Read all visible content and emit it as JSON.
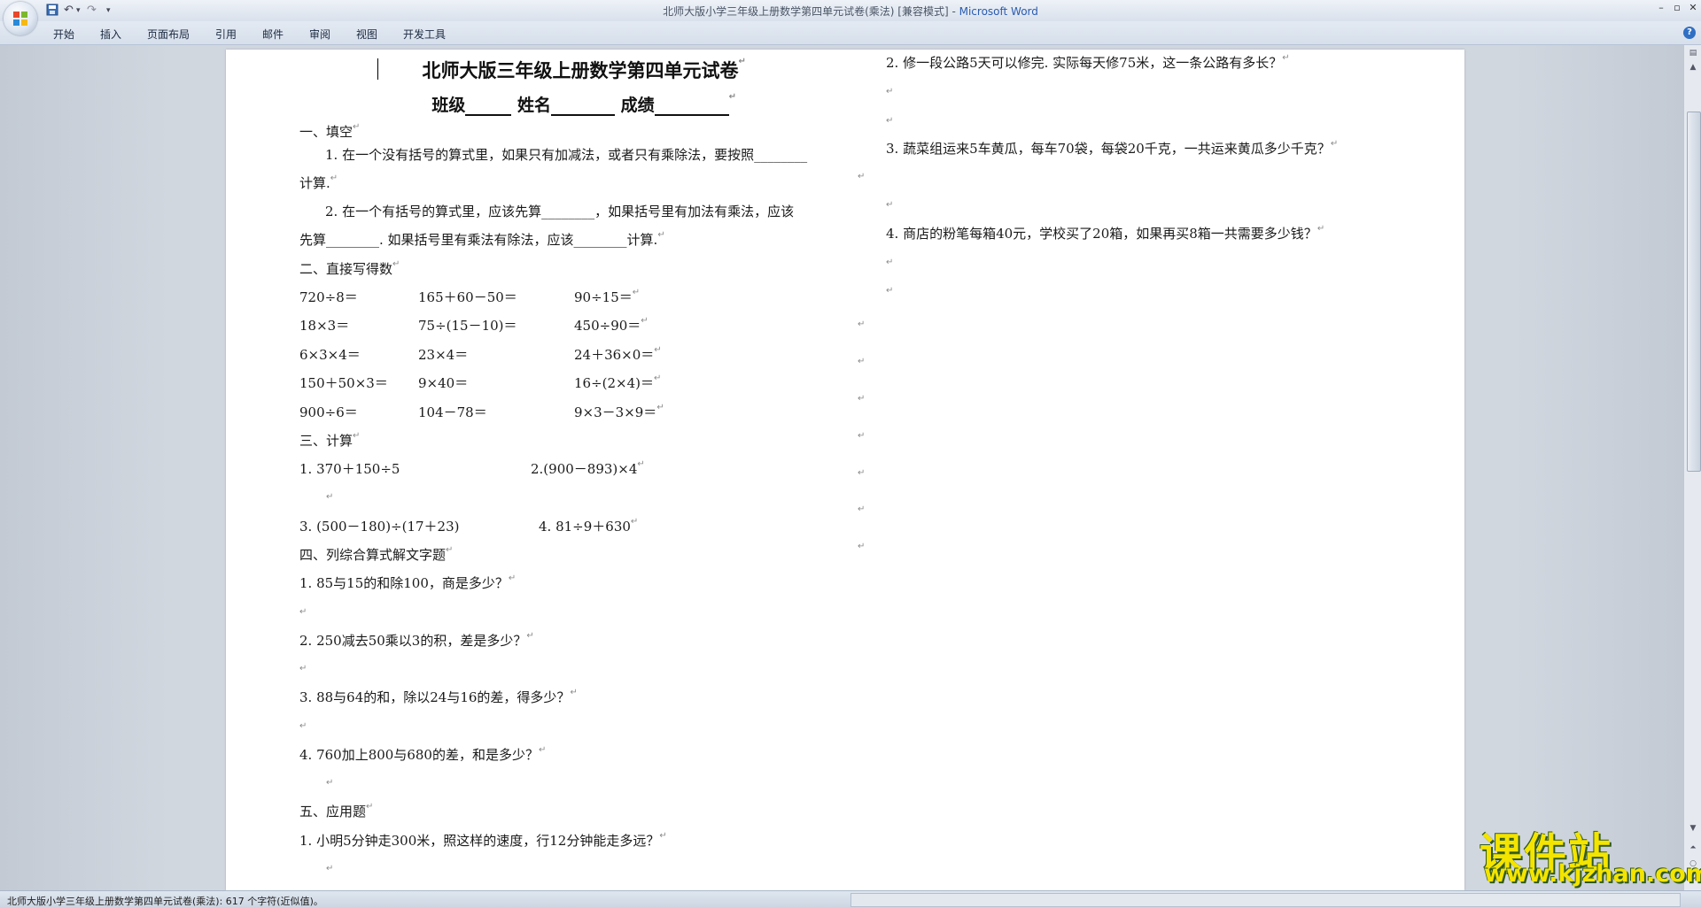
{
  "window": {
    "title": "北师大版小学三年级上册数学第四单元试卷(乘法) [兼容模式] - ",
    "app_name": "Microsoft Word"
  },
  "ribbon": {
    "tabs": [
      "开始",
      "插入",
      "页面布局",
      "引用",
      "邮件",
      "审阅",
      "视图",
      "开发工具"
    ]
  },
  "document": {
    "title": "北师大版三年级上册数学第四单元试卷",
    "info": {
      "class_label": "班级",
      "name_label": "姓名",
      "score_label": "成绩"
    },
    "left": {
      "s1": "一、填空",
      "q1a": "1. 在一个没有括号的算式里，如果只有加减法，或者只有乘除法，要按照________",
      "q1b": "计算.",
      "q2a": "2. 在一个有括号的算式里，应该先算________，如果括号里有加法有乘法，应该",
      "q2b": "先算________. 如果括号里有乘法有除法，应该________计算.",
      "s2": "二、直接写得数",
      "oral": [
        [
          "720÷8＝",
          "165＋60－50＝",
          "90÷15＝"
        ],
        [
          "18×3＝",
          "75÷(15－10)＝",
          "450÷90＝"
        ],
        [
          "6×3×4＝",
          "23×4＝",
          "24＋36×0＝"
        ],
        [
          "150＋50×3＝",
          "9×40＝",
          "16÷(2×4)＝"
        ],
        [
          "900÷6＝",
          "104－78＝",
          "9×3－3×9＝"
        ]
      ],
      "s3": "三、计算",
      "c1": "1. 370＋150÷5",
      "c2": "2.(900－893)×4",
      "c3": "3. (500－180)÷(17＋23)",
      "c4": "4. 81÷9＋630",
      "s4": "四、列综合算式解文字题",
      "w1": "1. 85与15的和除100，商是多少？",
      "w2": "2. 250减去50乘以3的积，差是多少？",
      "w3": "3. 88与64的和，除以24与16的差，得多少？",
      "w4": "4. 760加上800与680的差，和是多少？",
      "s5": "五、应用题",
      "a1": "1. 小明5分钟走300米，照这样的速度，行12分钟能走多远？"
    },
    "right": {
      "a2": "2. 修一段公路5天可以修完. 实际每天修75米，这一条公路有多长？",
      "a3": "3. 蔬菜组运来5车黄瓜，每车70袋，每袋20千克，一共运来黄瓜多少千克？",
      "a4": "4. 商店的粉笔每箱40元，学校买了20箱，如果再买8箱一共需要多少钱？"
    },
    "para_mark": "↵"
  },
  "status": {
    "text": "北师大版小学三年级上册数学第四单元试卷(乘法): 617 个字符(近似值)。"
  },
  "watermark": {
    "cn": "课件站",
    "url": "www.kjzhan.com"
  },
  "colors": {
    "watermark": "#f4e400",
    "app_name": "#2a5bb0"
  }
}
